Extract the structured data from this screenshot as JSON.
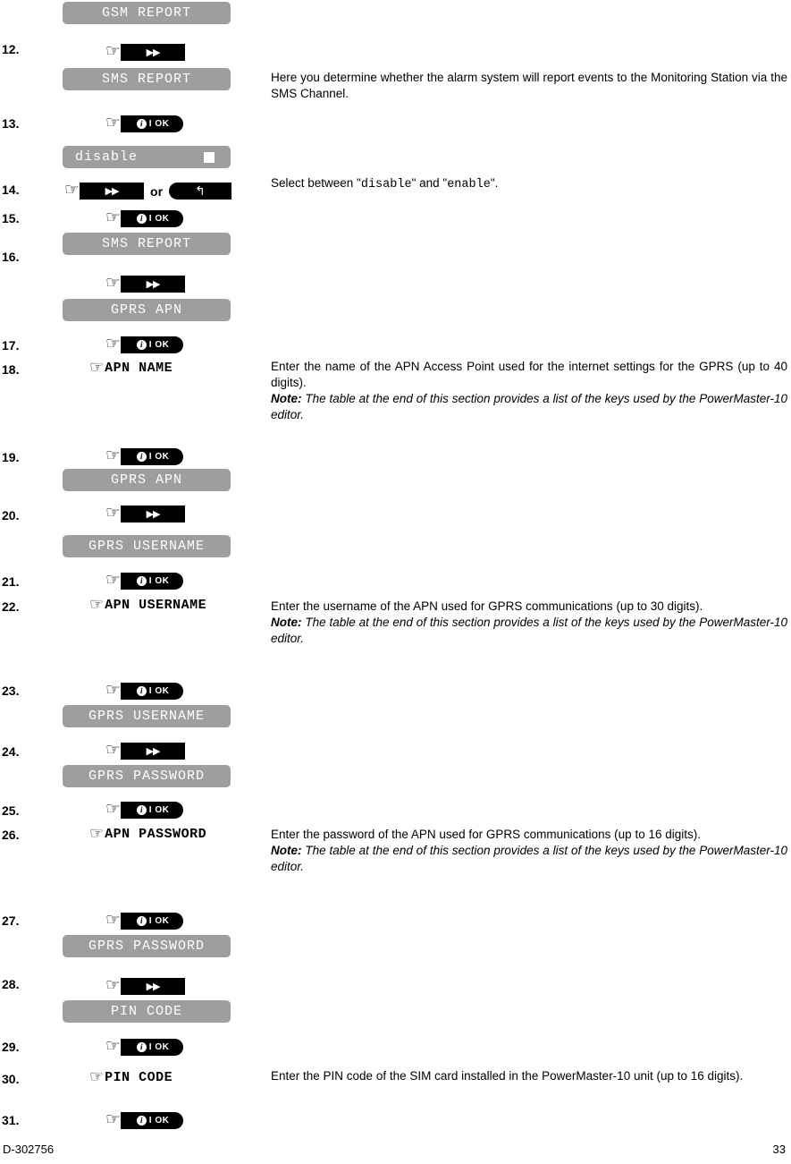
{
  "document": {
    "footer_left": "D-302756",
    "footer_right": "33"
  },
  "icons": {
    "hand": "☞",
    "next_arrows": "▶▶",
    "back_arrow": "↰",
    "info_badge": "i",
    "ok_label": "I OK"
  },
  "colors": {
    "lcd_background": "#9e9e9e",
    "lcd_text": "#ffffff",
    "key_background": "#000000",
    "key_text": "#ffffff",
    "page_text": "#000000"
  },
  "lcd_displays": {
    "gsm_report": "GSM REPORT",
    "sms_report": "SMS REPORT",
    "disable": "disable",
    "sms_report_2": "SMS REPORT",
    "gprs_apn": "GPRS APN",
    "gprs_apn_2": "GPRS APN",
    "gprs_username": "GPRS USERNAME",
    "gprs_username_2": "GPRS USERNAME",
    "gprs_password": "GPRS PASSWORD",
    "gprs_password_2": "GPRS PASSWORD",
    "pin_code": "PIN CODE"
  },
  "settings": {
    "apn_name": "APN NAME",
    "apn_username": "APN USERNAME",
    "apn_password": "APN PASSWORD",
    "pin_code": "PIN CODE"
  },
  "steps": {
    "s12": "12.",
    "s13": "13.",
    "s14": "14.",
    "s15": "15.",
    "s16": "16.",
    "s17": "17.",
    "s18": "18.",
    "s19": "19.",
    "s20": "20.",
    "s21": "21.",
    "s22": "22.",
    "s23": "23.",
    "s24": "24.",
    "s25": "25.",
    "s26": "26.",
    "s27": "27.",
    "s28": "28.",
    "s29": "29.",
    "s30": "30.",
    "s31": "31."
  },
  "keys": {
    "or": "or"
  },
  "descriptions": {
    "sms_report": "Here you determine whether the alarm system will report events to the Monitoring Station via the SMS Channel.",
    "select_prefix": "Select between \"",
    "select_disable": "disable",
    "select_middle": "\" and \"",
    "select_enable": "enable",
    "select_suffix": "\".",
    "apn_name_body": "Enter the name of the APN Access Point used for the internet settings for the GPRS (up to 40 digits).",
    "apn_username_body": "Enter the username of the APN used for GPRS communications (up to 30 digits).",
    "apn_password_body": "Enter the password of the APN used for GPRS communications (up to 16 digits).",
    "pin_code_body": "Enter the PIN code of the SIM card installed in the PowerMaster-10 unit (up to 16 digits).",
    "note_label": "Note:",
    "note_body": " The table at the end of this section provides a list of the keys used by the PowerMaster-10 editor."
  }
}
